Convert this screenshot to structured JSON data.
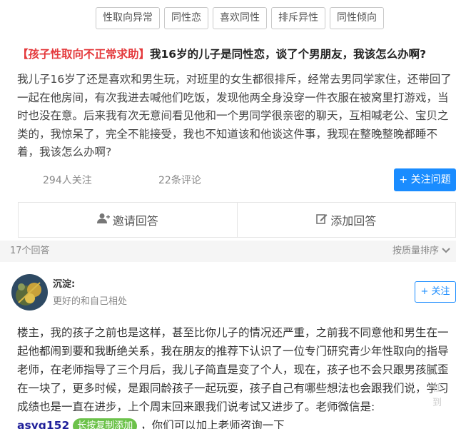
{
  "tags": [
    "性取向异常",
    "同性恋",
    "喜欢同性",
    "排斥异性",
    "同性倾向"
  ],
  "question": {
    "category": "【孩子性取向不正常求助】",
    "title": "我16岁的儿子是同性恋，谈了个男朋友，我该怎么办啊?",
    "body": "我儿子16岁了还是喜欢和男生玩，对班里的女生都很排斥，经常去男同学家住，还带回了一起在他房间，有次我进去喊他们吃饭，发现他两全身没穿一件衣服在被窝里打游戏，当时也没在意。后来我有次无意间看见他和一个男同学很亲密的聊天，互相喊老公、宝贝之类的，我惊呆了，完全不能接受，我也不知道该和他谈这件事，我现在整晚整晚都睡不着，我该怎么办啊?",
    "followers": "294人关注",
    "comments": "22条评论",
    "follow_button": "+ 关注问题"
  },
  "actions": {
    "invite": "邀请回答",
    "add": "添加回答"
  },
  "answers_bar": {
    "count": "17个回答",
    "sort": "按质量排序"
  },
  "answer": {
    "username": "沉淀:",
    "signature": "更好的和自己相处",
    "follow_button": "+ 关注",
    "text": "楼主，我的孩子之前也是这样，甚至比你儿子的情况还严重，之前我不同意他和男生在一起他都闹到要和我断绝关系，我在朋友的推荐下认识了一位专门研究青少年性取向的指导老师，在老师指导了三个月后，我儿子简直是变了个人，现在，孩子也不会只跟男孩腻歪在一块了，更多时候，是跟同龄孩子一起玩耍，孩子自己有哪些想法也会跟我们说，学习成绩也是一直在进步，上个周末回来跟我们说考试又进步了。老师微信是:",
    "wechat": "asyg152",
    "copy_label": "长按复制添加",
    "tail": "，你们可以加上老师咨询一下",
    "watermark": "任\n到"
  },
  "colors": {
    "accent": "#1a8cff",
    "category_red": "#e4393c",
    "copy_green": "#6cc24a"
  }
}
